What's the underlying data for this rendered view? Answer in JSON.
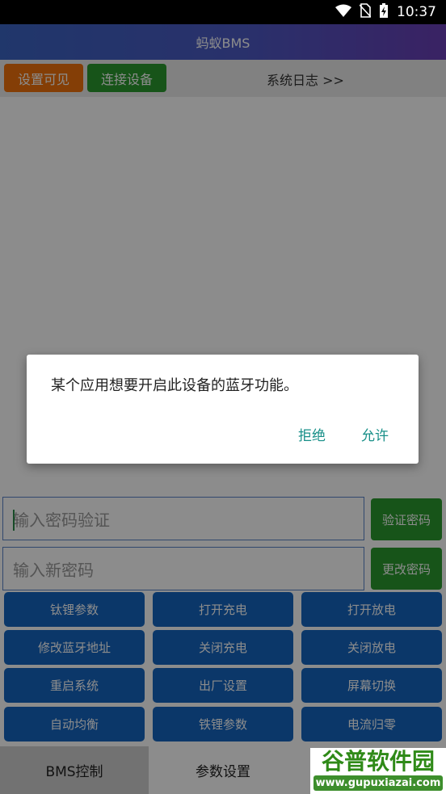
{
  "status_bar": {
    "time": "10:37",
    "icons": [
      "wifi-icon",
      "no-sim-icon",
      "battery-charging-icon"
    ]
  },
  "app": {
    "title": "蚂蚁BMS"
  },
  "toolbar": {
    "set_visible_label": "设置可见",
    "connect_device_label": "连接设备",
    "system_log_label": "系统日志 >>"
  },
  "password": {
    "verify_placeholder": "输入密码验证",
    "verify_button": "验证密码",
    "new_placeholder": "输入新密码",
    "change_button": "更改密码"
  },
  "control_buttons": [
    [
      "钛锂参数",
      "打开充电",
      "打开放电"
    ],
    [
      "修改蓝牙地址",
      "关闭充电",
      "关闭放电"
    ],
    [
      "重启系统",
      "出厂设置",
      "屏幕切换"
    ],
    [
      "自动均衡",
      "铁锂参数",
      "电流归零"
    ]
  ],
  "bottom_nav": {
    "tab1": "BMS控制",
    "tab2": "参数设置"
  },
  "dialog": {
    "message": "某个应用想要开启此设备的蓝牙功能。",
    "deny": "拒绝",
    "allow": "允许"
  },
  "watermark": {
    "brand": "谷普软件园",
    "url": "www.gupuxiazai.com"
  },
  "colors": {
    "accent_green": "#2a9a2e",
    "accent_orange": "#f0720c",
    "button_blue": "#1565c0",
    "dialog_text_button": "#178f88"
  }
}
